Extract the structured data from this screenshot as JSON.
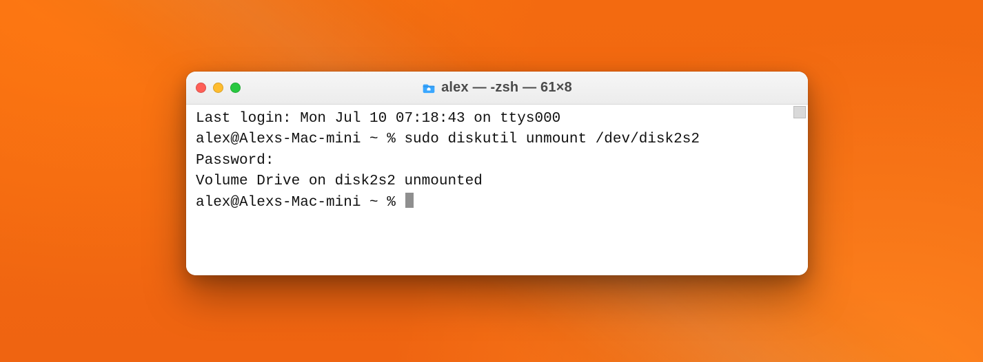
{
  "window": {
    "title": "alex — -zsh — 61×8"
  },
  "terminal": {
    "last_login": "Last login: Mon Jul 10 07:18:43 on ttys000",
    "prompt1": "alex@Alexs-Mac-mini ~ % ",
    "command1": "sudo diskutil unmount /dev/disk2s2",
    "password_line": "Password:",
    "output1": "Volume Drive on disk2s2 unmounted",
    "prompt2": "alex@Alexs-Mac-mini ~ % "
  }
}
